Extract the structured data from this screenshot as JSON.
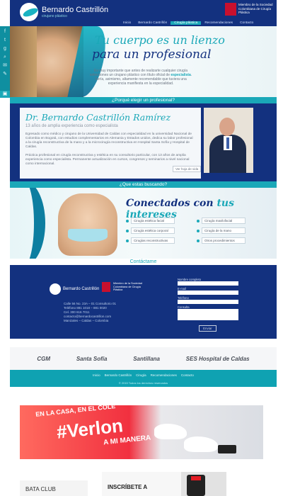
{
  "brand": {
    "name": "Bernardo Castrillón",
    "tagline": "cirujano plástico"
  },
  "society": "Miembro de la Sociedad Colombiana de Cirugía Plástica",
  "nav": [
    "Inicio",
    "Bernardo Castrillón",
    "Cirugía plástica",
    "Recomendaciones",
    "Contacto"
  ],
  "nav_active_index": 2,
  "hero": {
    "title_line1": "Tu cuerpo es un lienzo",
    "title_line2": "para un profesional",
    "text_pre": "Es muy importante que antes de realizarte cualquier cirugía selecciones un cirujano plástico con título oficial de",
    "text_bold": "especialista",
    "text_post": ". Sería, asimismo, altamente recomendable que tuviera una experiencia manifiesta en la especialidad."
  },
  "band_why": "¿Porqué elegir un profesional?",
  "about": {
    "name": "Dr. Bernardo Castrillón Ramírez",
    "years": "13 años de amplia experiencia como especialista",
    "p1": "Egresado como médico y cirujano de la Universidad de Caldas con especialidad en la universidad Nacional de Colombia en Bogotá, con estudios complementarios en Alemania y Estados unidos, dedica su labor profesional a la cirugía reconstructiva de la mano y a la microcirugía reconstructiva en Hospital Santa Sofía y Hospital de Caldas.",
    "p2": "Práctica profesional en cirugía reconstructiva y estética en su consultorio particular, con 13 años de amplia experiencia como especialista. Permanente actualización en cursos, congresos y seminarios a nivel nacional como internacional.",
    "button": "Ver hoja de vida"
  },
  "band_search": "¿Que estas buscando?",
  "interests": {
    "title_a": "Conectados con ",
    "title_b": "tus intereses",
    "items": [
      "Cirugía estética facial",
      "Cirugía maxilofacial",
      "Cirugía estética corporal",
      "Cirugía de la mano",
      "Cirugías reconstructivas",
      "Otros procedimientos"
    ]
  },
  "contact": {
    "heading": "Contáctame",
    "address": "Calle 56 No. 23A – 01 Consultorio 01",
    "phone": "Teléfono 881 1018 – 881 0020",
    "cell": "Cel. 300 616 7011",
    "email": "contacto@bernardocastrillon.com",
    "city": "Manizales – Caldas – Colombia",
    "form": {
      "name_label": "Nombre completo",
      "email_label": "E-mail",
      "phone_label": "Teléfono",
      "message_label": "Consulta",
      "submit": "Enviar"
    }
  },
  "partners": [
    "CGM",
    "Santa Sofía",
    "Santillana",
    "SES Hospital de Caldas"
  ],
  "footer": {
    "links": [
      "Inicio",
      "Bernardo Castrillón",
      "Cirugía",
      "Recomendaciones",
      "Contacto"
    ],
    "copyright": "© 2015 Todos los derechos reservados"
  },
  "ad1": {
    "top": "EN LA CASA, EN EL COLE",
    "main": "#Verlon",
    "sub": "A MI MANERA"
  },
  "ad2": {
    "brand": "BATA CLUB",
    "cta": "INSCRÍBETE A"
  },
  "colors": {
    "navy": "#13317f",
    "teal": "#1aa8b8",
    "red": "#c8102e"
  }
}
